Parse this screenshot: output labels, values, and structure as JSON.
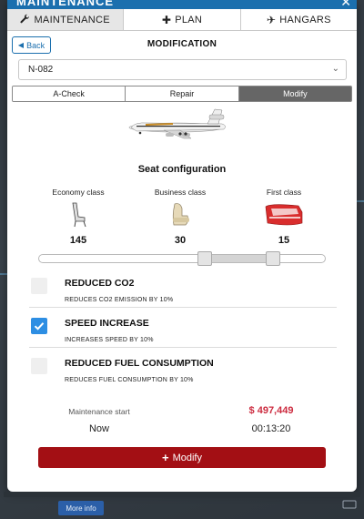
{
  "header": {
    "title_fragment": "MAINTENANCE",
    "close_glyph": "✕"
  },
  "tabs": [
    {
      "label": "MAINTENANCE",
      "icon": "wrench-icon",
      "glyph": "🔧",
      "active": true
    },
    {
      "label": "PLAN",
      "icon": "plus-icon",
      "glyph": "✚",
      "active": false
    },
    {
      "label": "HANGARS",
      "icon": "plane-icon",
      "glyph": "✈",
      "active": false
    }
  ],
  "back": {
    "label": "Back",
    "glyph": "◀"
  },
  "section_title": "MODIFICATION",
  "aircraft_select": {
    "value": "N-082",
    "chevron": "⌄"
  },
  "segments": [
    {
      "label": "A-Check",
      "active": false
    },
    {
      "label": "Repair",
      "active": false
    },
    {
      "label": "Modify",
      "active": true
    }
  ],
  "seat_config": {
    "title": "Seat configuration",
    "classes": [
      {
        "label": "Economy class",
        "count": "145",
        "icon": "economy-seat-icon"
      },
      {
        "label": "Business class",
        "count": "30",
        "icon": "business-seat-icon"
      },
      {
        "label": "First class",
        "count": "15",
        "icon": "first-class-seat-icon"
      }
    ],
    "slider": {
      "handle1_fraction": 0.58,
      "handle2_fraction": 0.82
    }
  },
  "options": [
    {
      "name": "REDUCED CO2",
      "desc": "REDUCES CO2 EMISSION BY 10%",
      "checked": false
    },
    {
      "name": "SPEED INCREASE",
      "desc": "INCREASES SPEED BY 10%",
      "checked": true
    },
    {
      "name": "REDUCED FUEL CONSUMPTION",
      "desc": "REDUCES FUEL CONSUMPTION BY 10%",
      "checked": false
    }
  ],
  "maintenance": {
    "start_label": "Maintenance start",
    "start_value": "Now",
    "price": "$ 497,449",
    "duration": "00:13:20"
  },
  "modify_button": {
    "label": "Modify",
    "glyph": "+"
  },
  "more_info": {
    "label": "More info"
  },
  "colors": {
    "accent": "#1b6fae",
    "danger": "#a30f14",
    "price": "#cc2b3f",
    "check": "#2d8ee3"
  }
}
